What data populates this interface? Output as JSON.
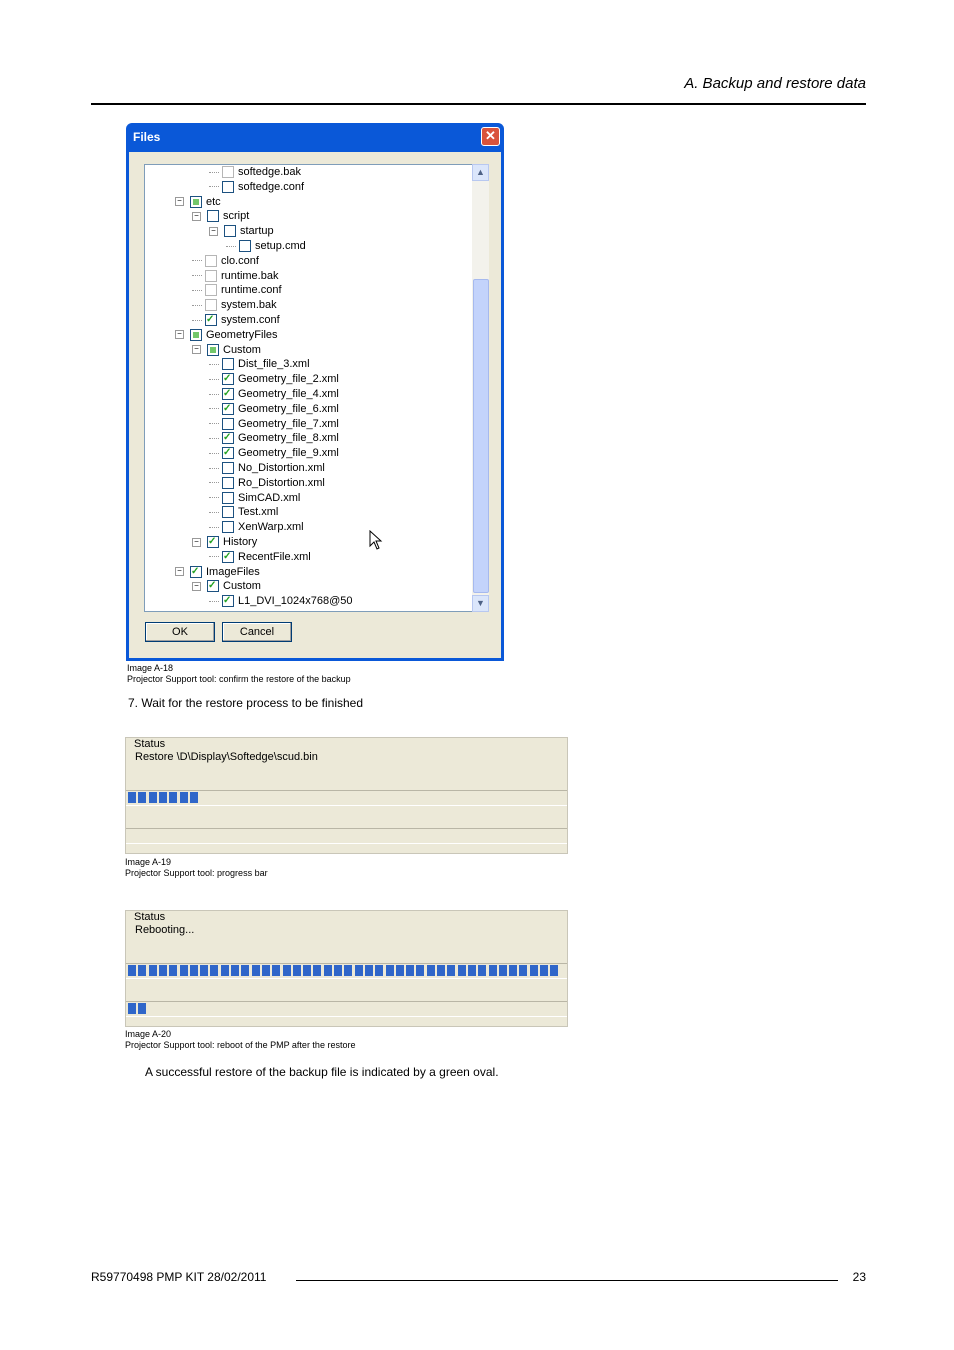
{
  "header": {
    "title": "A. Backup and restore data"
  },
  "dialog": {
    "title": "Files",
    "close": "✕",
    "ok_label": "OK",
    "cancel_label": "Cancel",
    "tree": [
      {
        "label": "softedge.bak",
        "indent": 3,
        "check": "gray",
        "exp": ""
      },
      {
        "label": "softedge.conf",
        "indent": 3,
        "check": "none",
        "exp": ""
      },
      {
        "label": "etc",
        "indent": 1,
        "check": "partial",
        "exp": "-"
      },
      {
        "label": "script",
        "indent": 2,
        "check": "none",
        "exp": "-"
      },
      {
        "label": "startup",
        "indent": 3,
        "check": "none",
        "exp": "-"
      },
      {
        "label": "setup.cmd",
        "indent": 4,
        "check": "none",
        "exp": ""
      },
      {
        "label": "clo.conf",
        "indent": 2,
        "check": "gray",
        "exp": ""
      },
      {
        "label": "runtime.bak",
        "indent": 2,
        "check": "gray",
        "exp": ""
      },
      {
        "label": "runtime.conf",
        "indent": 2,
        "check": "gray",
        "exp": ""
      },
      {
        "label": "system.bak",
        "indent": 2,
        "check": "gray",
        "exp": ""
      },
      {
        "label": "system.conf",
        "indent": 2,
        "check": "checked",
        "exp": ""
      },
      {
        "label": "GeometryFiles",
        "indent": 1,
        "check": "partial",
        "exp": "-"
      },
      {
        "label": "Custom",
        "indent": 2,
        "check": "partial",
        "exp": "-"
      },
      {
        "label": "Dist_file_3.xml",
        "indent": 3,
        "check": "none",
        "exp": ""
      },
      {
        "label": "Geometry_file_2.xml",
        "indent": 3,
        "check": "checked",
        "exp": ""
      },
      {
        "label": "Geometry_file_4.xml",
        "indent": 3,
        "check": "checked",
        "exp": ""
      },
      {
        "label": "Geometry_file_6.xml",
        "indent": 3,
        "check": "checked",
        "exp": ""
      },
      {
        "label": "Geometry_file_7.xml",
        "indent": 3,
        "check": "none",
        "exp": ""
      },
      {
        "label": "Geometry_file_8.xml",
        "indent": 3,
        "check": "checked",
        "exp": ""
      },
      {
        "label": "Geometry_file_9.xml",
        "indent": 3,
        "check": "checked",
        "exp": ""
      },
      {
        "label": "No_Distortion.xml",
        "indent": 3,
        "check": "none",
        "exp": ""
      },
      {
        "label": "Ro_Distortion.xml",
        "indent": 3,
        "check": "none",
        "exp": ""
      },
      {
        "label": "SimCAD.xml",
        "indent": 3,
        "check": "none",
        "exp": ""
      },
      {
        "label": "Test.xml",
        "indent": 3,
        "check": "none",
        "exp": ""
      },
      {
        "label": "XenWarp.xml",
        "indent": 3,
        "check": "none",
        "exp": ""
      },
      {
        "label": "History",
        "indent": 2,
        "check": "checked",
        "exp": "-"
      },
      {
        "label": "RecentFile.xml",
        "indent": 3,
        "check": "checked",
        "exp": ""
      },
      {
        "label": "ImageFiles",
        "indent": 1,
        "check": "checked",
        "exp": "-"
      },
      {
        "label": "Custom",
        "indent": 2,
        "check": "checked",
        "exp": "-"
      },
      {
        "label": "L1_DVI_1024x768@50",
        "indent": 3,
        "check": "checked",
        "exp": ""
      }
    ]
  },
  "captions": {
    "a18_num": "Image A-18",
    "a18_text": "Projector Support tool: confirm the restore of the backup",
    "a19_num": "Image A-19",
    "a19_text": "Projector Support tool: progress bar",
    "a20_num": "Image A-20",
    "a20_text": "Projector Support tool: reboot of the PMP after the restore"
  },
  "step7": "7.  Wait for the restore process to be finished",
  "status1": {
    "group": "Status",
    "message": "Restore \\D\\Display\\Softedge\\scud.bin",
    "progress_segments": 7,
    "lower_progress_segments": 0
  },
  "status2": {
    "group": "Status",
    "message": "Rebooting...",
    "progress_segments": 42,
    "lower_progress_segments": 2
  },
  "paragraph": "A successful restore of the backup file is indicated by a green oval.",
  "footer": {
    "left": "R59770498   PMP KIT  28/02/2011",
    "page": "23"
  },
  "colors": {
    "title_bar": "#0a58d8",
    "progress": "#2f66c9",
    "dialog_bg": "#ece9d8"
  }
}
